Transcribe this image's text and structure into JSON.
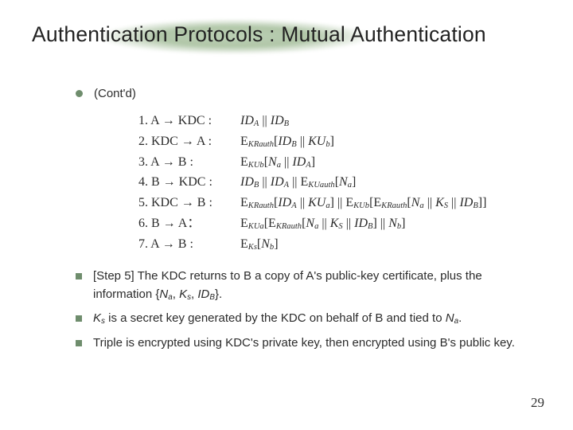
{
  "title": "Authentication Protocols : Mutual Authentication",
  "subhead": "(Cont'd)",
  "steps": [
    {
      "l": "1. A → KDC :",
      "r_html": "<span class='i'>ID<sub>A</sub></span> || <span class='i'>ID<sub>B</sub></span>"
    },
    {
      "l": "2. KDC → A :",
      "r_html": "E<sub>KRauth</sub>[<span class='i'>ID<sub>B</sub></span> || <span class='i'>KU<sub>b</sub></span>]"
    },
    {
      "l": "3. A → B :",
      "r_html": "E<sub>KUb</sub>[<span class='i'>N<sub>a</sub></span> || <span class='i'>ID<sub>A</sub></span>]"
    },
    {
      "l": "4. B → KDC :",
      "r_html": "<span class='i'>ID<sub>B</sub></span> || <span class='i'>ID<sub>A</sub></span> || E<sub>KUauth</sub>[<span class='i'>N<sub>a</sub></span>]"
    },
    {
      "l": "5. KDC → B :",
      "r_html": "E<sub>KRauth</sub>[<span class='i'>ID<sub>A</sub></span> || <span class='i'>KU<sub>a</sub></span>] || E<sub>KUb</sub>[E<sub>KRauth</sub>[<span class='i'>N<sub>a</sub></span> || <span class='i'>K<sub>S</sub></span> || <span class='i'>ID<sub>B</sub></span>]]"
    },
    {
      "l": "6. B → A：",
      "r_html": "E<sub>KUa</sub>[E<sub>KRauth</sub>[<span class='i'>N<sub>a</sub></span> || <span class='i'>K<sub>S</sub></span> || <span class='i'>ID<sub>B</sub></span>] || <span class='i'>N<sub>b</sub></span>]"
    },
    {
      "l": "7. A → B :",
      "r_html": "E<sub>Ks</sub>[<span class='i'>N<sub>b</sub></span>]"
    }
  ],
  "bullets": [
    "[Step 5] The KDC returns to B a copy of A's public-key certificate, plus the information {N_a, K_s, ID_B}.",
    "K_s is a secret key generated by the KDC on behalf of B and tied to N_a.",
    "Triple is encrypted using KDC's private key, then encrypted using B's public key."
  ],
  "bullets_html": [
    "[Step 5] The KDC returns to B a copy of A's public-key certificate, plus the information {<span class='i'>N<sub>a</sub></span>, <span class='i'>K<sub>s</sub></span>, <span class='i'>ID<sub>B</sub></span>}.",
    "<span class='i'>K<sub>s</sub></span> is a secret key generated by the KDC on behalf of B and tied to <span class='i'>N<sub>a</sub></span>.",
    "Triple is encrypted using KDC's private key, then encrypted using B's public key."
  ],
  "page_number": "29"
}
